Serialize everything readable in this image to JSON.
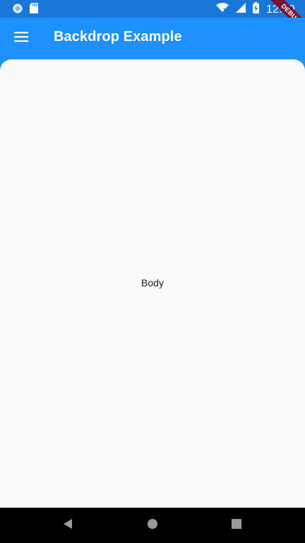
{
  "status_bar": {
    "time": "12:10",
    "icons": [
      "notification-circle-icon",
      "sd-card-icon",
      "wifi-icon",
      "signal-icon",
      "battery-charging-icon"
    ]
  },
  "debug_banner": {
    "label": "DEBUG"
  },
  "app_bar": {
    "title": "Backdrop Example",
    "menu_icon": "menu-icon"
  },
  "body": {
    "text": "Body"
  },
  "nav_bar": {
    "icons": [
      "back-icon",
      "home-icon",
      "recents-icon"
    ]
  },
  "colors": {
    "primary": "#1e90ff",
    "status_bar": "#1877d8",
    "sheet": "#f9f9fc",
    "debug_ribbon": "#7a1232"
  }
}
